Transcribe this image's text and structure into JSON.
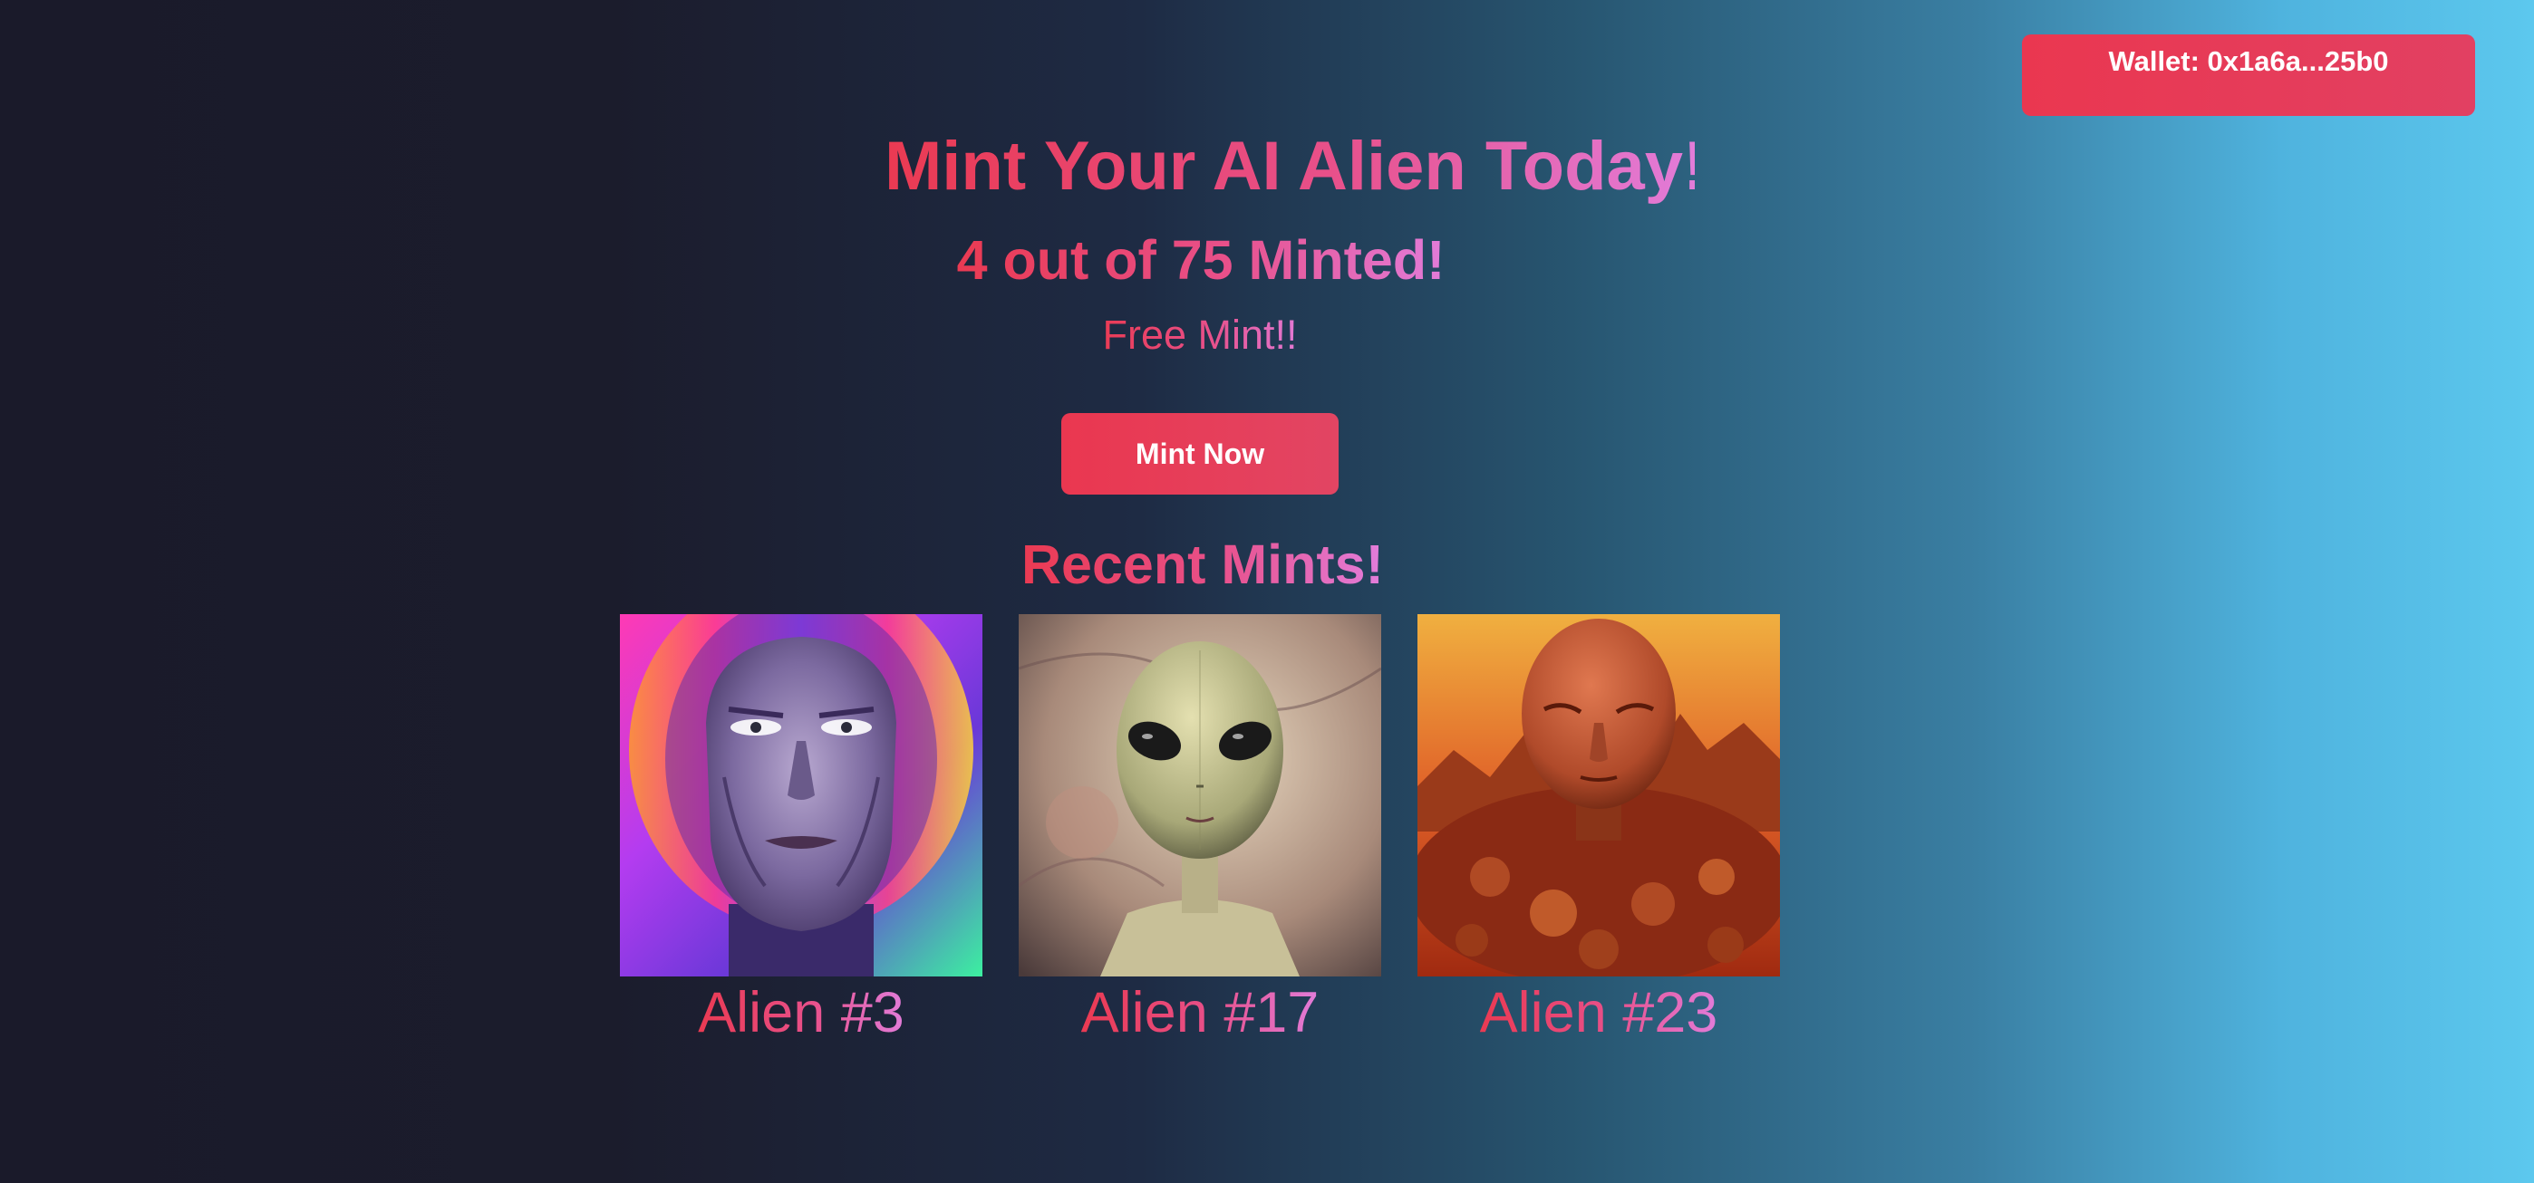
{
  "header": {
    "wallet_label": "Wallet: 0x1a6a...25b0"
  },
  "hero": {
    "title": "Mint Your AI Alien Today!!",
    "minted_status": "4 out of 75 Minted!",
    "price_note": "Free Mint!!",
    "mint_button_label": "Mint Now"
  },
  "recent": {
    "heading": "Recent Mints!",
    "items": [
      {
        "name": "Alien #3",
        "image": "psychedelic-alien-portrait"
      },
      {
        "name": "Alien #17",
        "image": "grey-alien-portrait"
      },
      {
        "name": "Alien #23",
        "image": "red-martian-alien-portrait"
      }
    ]
  },
  "colors": {
    "accent_start": "#ea3a52",
    "accent_end": "#e27cd9",
    "button": "#ea3750",
    "background_dark": "#1a1a2a",
    "background_light": "#5cc8ee"
  }
}
